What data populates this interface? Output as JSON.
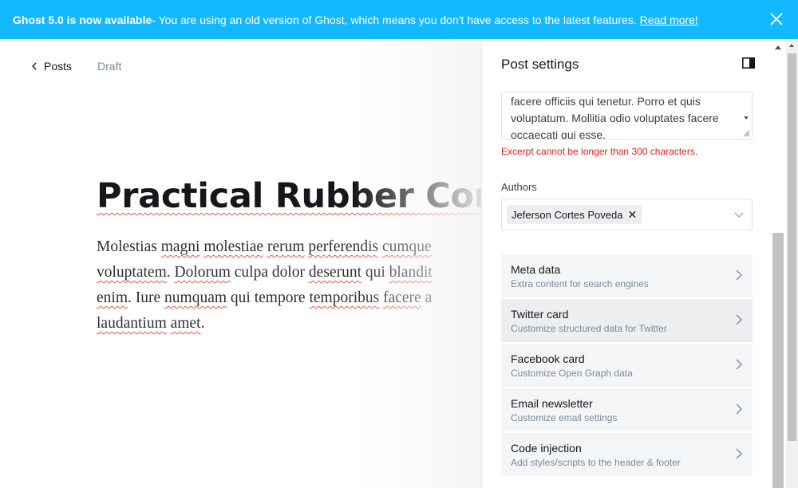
{
  "banner": {
    "headline": "Ghost 5.0 is now available",
    "message": " - You are using an old version of Ghost, which means you don't have access to the latest features.",
    "link": "Read more!",
    "close_icon": "close-icon"
  },
  "editor": {
    "back_label": "Posts",
    "status": "Draft",
    "title": "Practical Rubber Com",
    "body_lines": [
      [
        "Molestias ",
        "magni",
        " ",
        "molestiae",
        " ",
        "rerum",
        " ",
        "perferendis",
        " ",
        "cumque"
      ],
      [
        "voluptatem",
        ". ",
        "Dolorum",
        " culpa dolor ",
        "deserunt",
        " qui ",
        "blandit"
      ],
      [
        "enim",
        ". Iure ",
        "numquam",
        " qui tempore ",
        "temporibus",
        " ",
        "facere",
        " a"
      ],
      [
        "laudantium",
        " ",
        "amet",
        "."
      ]
    ]
  },
  "panel": {
    "title": "Post settings",
    "toggle_icon": "sidebar-toggle-icon",
    "excerpt": "facere officiis qui tenetur. Porro et quis voluptatum. Mollitia odio voluptates facere occaecati qui esse.",
    "excerpt_error": "Excerpt cannot be longer than 300 characters.",
    "authors_label": "Authors",
    "author": "Jeferson Cortes Poveda",
    "nav": [
      {
        "title": "Meta data",
        "subtitle": "Extra content for search engines"
      },
      {
        "title": "Twitter card",
        "subtitle": "Customize structured data for Twitter"
      },
      {
        "title": "Facebook card",
        "subtitle": "Customize Open Graph data"
      },
      {
        "title": "Email newsletter",
        "subtitle": "Customize email settings"
      },
      {
        "title": "Code injection",
        "subtitle": "Add styles/scripts to the header & footer"
      }
    ]
  },
  "colors": {
    "banner": "#14b8ff",
    "error": "#e01e1e",
    "spellcheck": "#e25440"
  }
}
